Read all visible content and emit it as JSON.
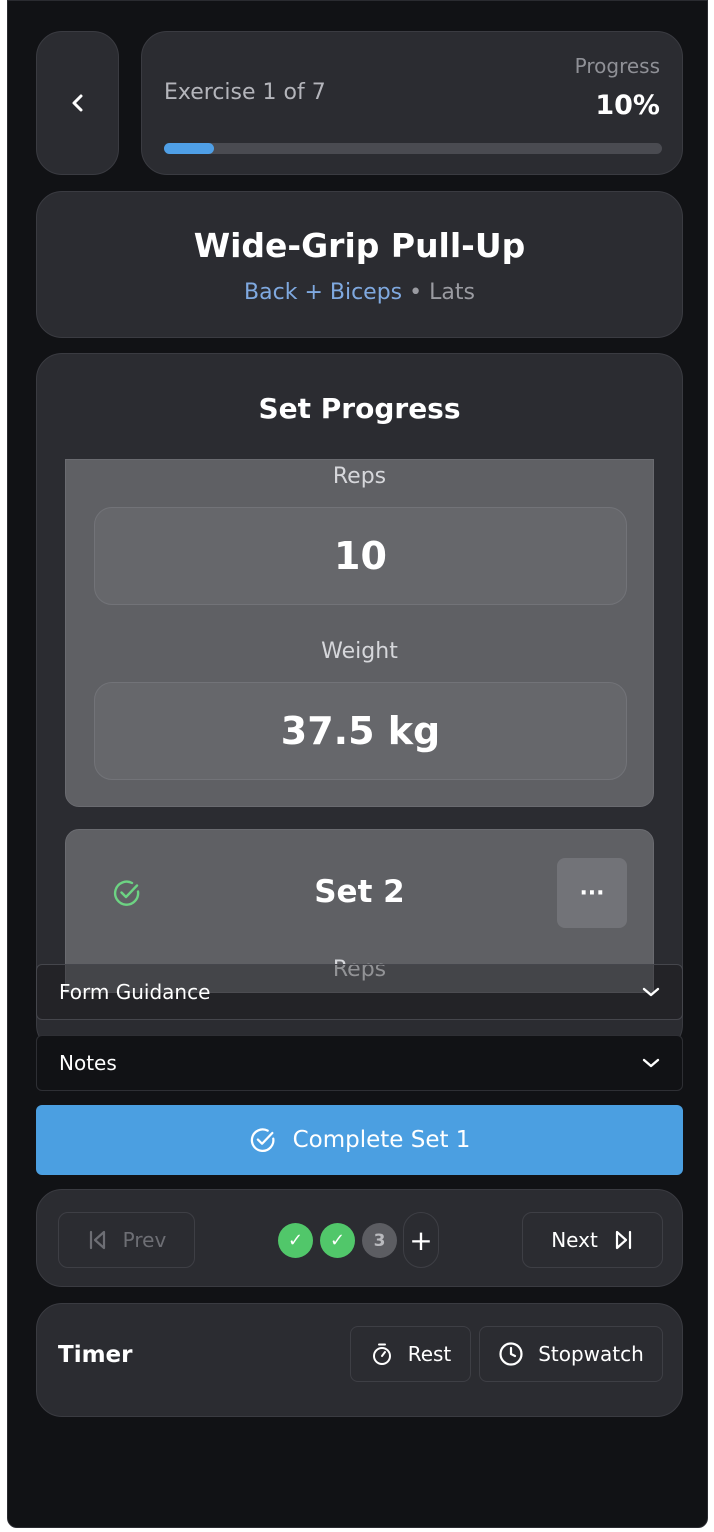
{
  "header": {
    "back_icon": "chevron-left-icon",
    "exercise_count": "Exercise 1 of 7",
    "progress_label": "Progress",
    "progress_text": "10%",
    "progress_fraction": 0.1
  },
  "exercise": {
    "title": "Wide-Grip Pull-Up",
    "primary_muscles": "Back + Biceps",
    "secondary_muscles": "• Lats"
  },
  "set_progress": {
    "title": "Set Progress",
    "current_set": {
      "reps_label": "Reps",
      "reps_value": "10",
      "weight_label": "Weight",
      "weight_value": "37.5 kg"
    },
    "next_set": {
      "title": "Set 2",
      "reps_label": "Reps",
      "more_label": "···"
    }
  },
  "accordions": {
    "form_guidance": "Form Guidance",
    "notes": "Notes"
  },
  "complete_button": {
    "label": "Complete Set 1"
  },
  "set_nav": {
    "prev_label": "Prev",
    "next_label": "Next",
    "dots": [
      {
        "label": "✓",
        "state": "done"
      },
      {
        "label": "✓",
        "state": "done"
      },
      {
        "label": "3",
        "state": "pending"
      }
    ],
    "add_label": "+"
  },
  "timer": {
    "label": "Timer",
    "rest_label": "Rest",
    "stopwatch_label": "Stopwatch"
  },
  "colors": {
    "accent": "#4b9fe1",
    "success": "#51c76a",
    "background": "#111215",
    "card": "#2b2c31"
  }
}
